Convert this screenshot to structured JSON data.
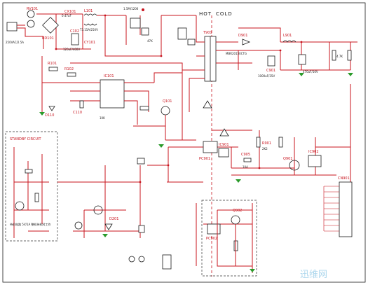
{
  "regions": {
    "hot_label": "HOT",
    "cold_label": "COLD",
    "standby_circuit": "STANDBY CIRCUIT"
  },
  "refs": {
    "rv101": "RV101",
    "cx101": "CX101",
    "l101": "L101",
    "cy101": "CY101",
    "bd101": "BD101",
    "c102": "C102",
    "ic101": "IC101",
    "q101": "Q101",
    "t901": "T901",
    "d901": "D901",
    "c901": "C901",
    "l901": "L901",
    "ic901": "IC901",
    "pc901": "PC901",
    "ic902": "IC902",
    "q901": "Q901",
    "q902": "Q902",
    "cn901": "CN901",
    "pc902": "PC902",
    "d201": "D201",
    "r901": "R901",
    "c905": "C905",
    "r101": "R101",
    "r102": "R102",
    "c110": "C110",
    "d110": "D110"
  },
  "values": {
    "fuse": "T3.15A/250V",
    "mains": "250VAC/2.5A",
    "cap_bulk": "120uF/400V",
    "cap_x": "0.47uF",
    "res_1m": "1.5M/1206",
    "res_47k": "47K",
    "res_10k": "10K",
    "cap_1000u": "1000uF/35V",
    "cap_470u": "470uF/16V",
    "diode_mbr": "MBR20150CTG",
    "res_2k2": "2K2",
    "cap_104": "104",
    "res_4k7": "4.7K"
  },
  "notes": {
    "standby_note": "待机电路 5V/1A  整机待机时工作"
  },
  "watermark": "迅维网"
}
